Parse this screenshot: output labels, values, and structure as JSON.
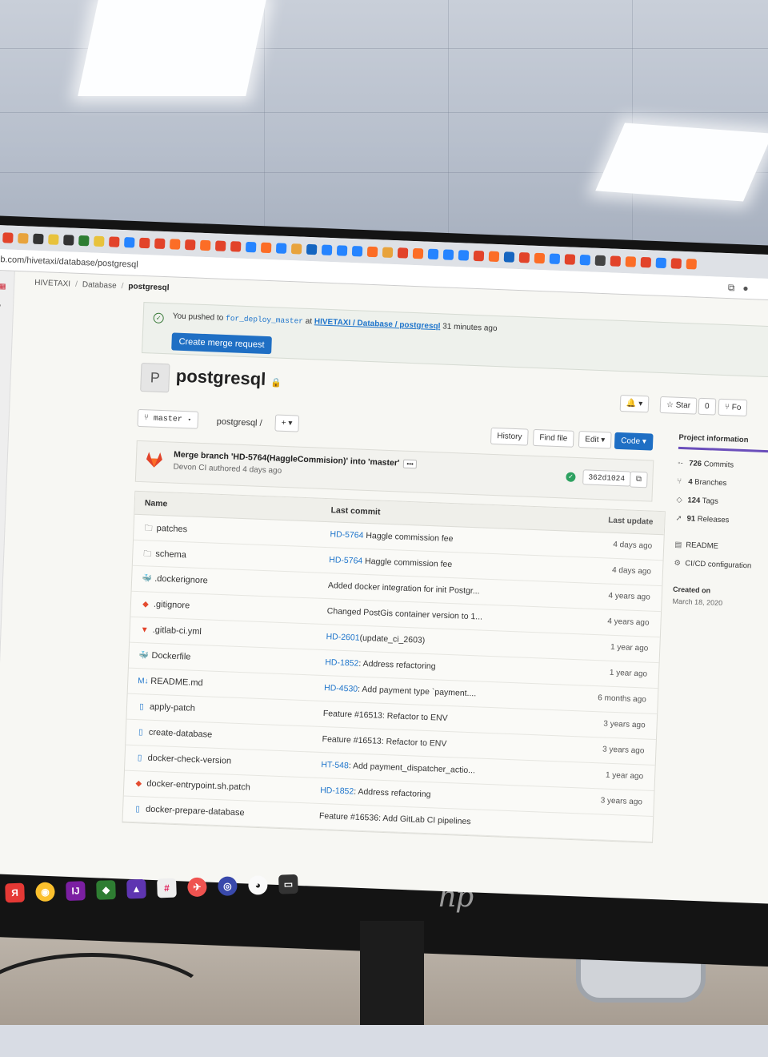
{
  "browser": {
    "url": "b.com/hivetaxi/database/postgresql"
  },
  "breadcrumb": {
    "group": "HIVETAXI",
    "subgroup": "Database",
    "project": "postgresql"
  },
  "alert": {
    "prefix": "You pushed to",
    "branch": "for_deploy_master",
    "at": "at",
    "repo_link": "HIVETAXI / Database / postgresql",
    "time": "31 minutes ago",
    "button": "Create merge request"
  },
  "project": {
    "avatar_letter": "P",
    "name": "postgresql"
  },
  "header_actions": {
    "notifications": "🔔",
    "star_label": "Star",
    "star_count": "0",
    "fork_label": "Fo"
  },
  "toolbar": {
    "branch": "master",
    "path": "postgresql",
    "path_sep": "/",
    "add": "+",
    "history": "History",
    "find_file": "Find file",
    "edit": "Edit",
    "code": "Code"
  },
  "last_commit": {
    "title": "Merge branch 'HD-5764(HaggleCommision)' into 'master'",
    "author_line": "Devon CI authored 4 days ago",
    "sha": "362d1024"
  },
  "file_table": {
    "headers": {
      "name": "Name",
      "last_commit": "Last commit",
      "last_update": "Last update"
    },
    "rows": [
      {
        "icon": "folder",
        "name": "patches",
        "ref": "HD-5764",
        "commit": " Haggle commission fee",
        "updated": "4 days ago"
      },
      {
        "icon": "folder",
        "name": "schema",
        "ref": "HD-5764",
        "commit": " Haggle commission fee",
        "updated": "4 days ago"
      },
      {
        "icon": "docker",
        "name": ".dockerignore",
        "ref": "",
        "commit": "Added docker integration for init Postgr...",
        "updated": "4 years ago"
      },
      {
        "icon": "git",
        "name": ".gitignore",
        "ref": "",
        "commit": "Changed PostGis container version to 1...",
        "updated": "4 years ago"
      },
      {
        "icon": "gitlab",
        "name": ".gitlab-ci.yml",
        "ref": "HD-2601",
        "commit": "(update_ci_2603)",
        "updated": "1 year ago"
      },
      {
        "icon": "docker",
        "name": "Dockerfile",
        "ref": "HD-1852",
        "commit": ": Address refactoring",
        "updated": "1 year ago"
      },
      {
        "icon": "markdown",
        "name": "README.md",
        "ref": "HD-4530",
        "commit": ": Add payment type `payment....",
        "updated": "6 months ago"
      },
      {
        "icon": "file",
        "name": "apply-patch",
        "ref": "",
        "commit": "Feature #16513: Refactor to ENV",
        "updated": "3 years ago"
      },
      {
        "icon": "file",
        "name": "create-database",
        "ref": "",
        "commit": "Feature #16513: Refactor to ENV",
        "updated": "3 years ago"
      },
      {
        "icon": "file",
        "name": "docker-check-version",
        "ref": "HT-548",
        "commit": ": Add payment_dispatcher_actio...",
        "updated": "1 year ago"
      },
      {
        "icon": "git",
        "name": "docker-entrypoint.sh.patch",
        "ref": "HD-1852",
        "commit": ": Address refactoring",
        "updated": "3 years ago"
      },
      {
        "icon": "file",
        "name": "docker-prepare-database",
        "ref": "",
        "commit": "Feature #16536: Add GitLab CI pipelines",
        "updated": ""
      }
    ]
  },
  "sidebar": {
    "tab": "Project information",
    "stats": [
      {
        "icon": "commit",
        "count": "726",
        "label": " Commits"
      },
      {
        "icon": "branch",
        "count": "4",
        "label": " Branches"
      },
      {
        "icon": "tag",
        "count": "124",
        "label": " Tags"
      },
      {
        "icon": "rocket",
        "count": "91",
        "label": " Releases"
      }
    ],
    "readme": "README",
    "cicd": "CI/CD configuration",
    "created_label": "Created on",
    "created_date": "March 18, 2020"
  },
  "colors": {
    "link": "#1f75cb",
    "primary_button": "#1f6fc4",
    "success": "#2da160",
    "sidebar_accent": "#6b4fbb"
  }
}
